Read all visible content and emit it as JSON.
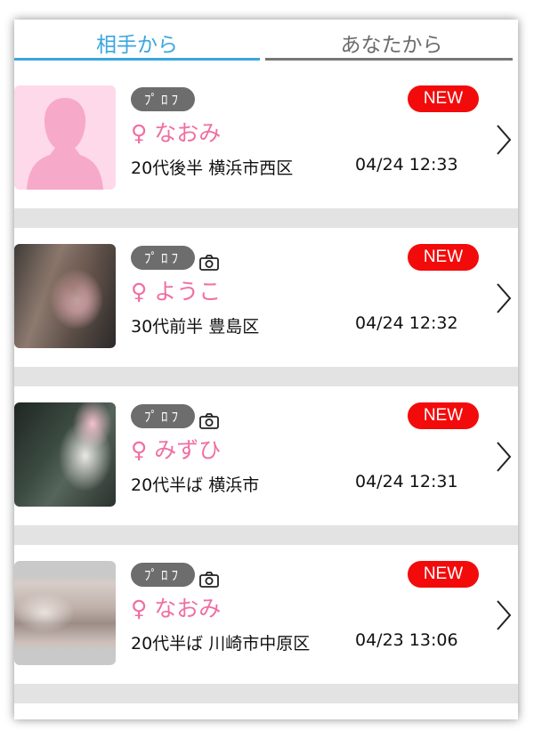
{
  "tabs": [
    {
      "label": "相手から",
      "active": true
    },
    {
      "label": "あなたから",
      "active": false
    }
  ],
  "colors": {
    "accent": "#3aa6e0",
    "name_pink": "#ef6fa3",
    "new_badge": "#f30b0b",
    "profile_badge": "#6d6d6d",
    "separator": "#e3e3e3"
  },
  "rows": [
    {
      "badge": "ﾌﾟﾛﾌ",
      "has_photo": false,
      "new_label": "NEW",
      "gender_icon": "♀",
      "name": "なおみ",
      "age": "20代後半",
      "area": "横浜市西区",
      "time": "04/24 12:33",
      "avatar": "pink-silhouette"
    },
    {
      "badge": "ﾌﾟﾛﾌ",
      "has_photo": true,
      "new_label": "NEW",
      "gender_icon": "♀",
      "name": "ようこ",
      "age": "30代前半",
      "area": "豊島区",
      "time": "04/24 12:32",
      "avatar": "blurred-photo"
    },
    {
      "badge": "ﾌﾟﾛﾌ",
      "has_photo": true,
      "new_label": "NEW",
      "gender_icon": "♀",
      "name": "みずひ",
      "age": "20代半ば",
      "area": "横浜市",
      "time": "04/24 12:31",
      "avatar": "blurred-photo"
    },
    {
      "badge": "ﾌﾟﾛﾌ",
      "has_photo": true,
      "new_label": "NEW",
      "gender_icon": "♀",
      "name": "なおみ",
      "age": "20代半ば",
      "area": "川崎市中原区",
      "time": "04/23 13:06",
      "avatar": "blurred-photo"
    }
  ]
}
